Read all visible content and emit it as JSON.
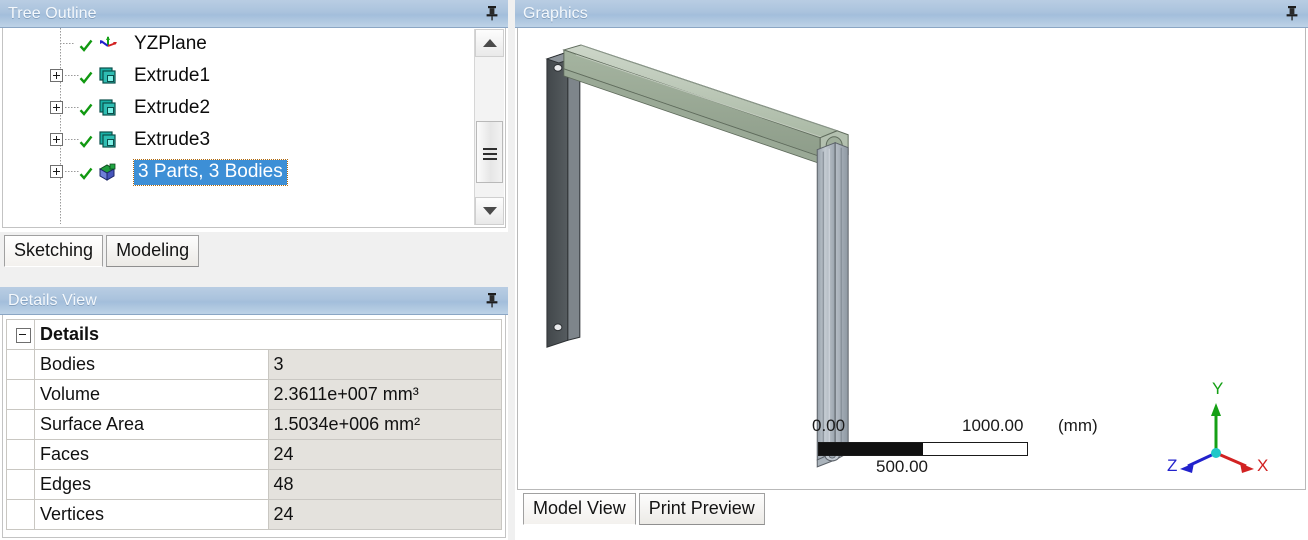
{
  "tree_panel": {
    "title": "Tree Outline",
    "pin_icon": "pushpin-icon",
    "items": [
      {
        "label": "YZPlane",
        "icon": "plane-triad-icon",
        "expandable": false,
        "suppressed": false,
        "selected": false,
        "check": "green-check-icon"
      },
      {
        "label": "Extrude1",
        "icon": "extrude-body-icon",
        "expandable": true,
        "suppressed": false,
        "selected": false,
        "check": "green-check-icon"
      },
      {
        "label": "Extrude2",
        "icon": "extrude-body-icon",
        "expandable": true,
        "suppressed": false,
        "selected": false,
        "check": "green-check-icon"
      },
      {
        "label": "Extrude3",
        "icon": "extrude-body-icon",
        "expandable": true,
        "suppressed": false,
        "selected": false,
        "check": "green-check-icon"
      },
      {
        "label": "3 Parts, 3 Bodies",
        "icon": "parts-bodies-icon",
        "expandable": true,
        "suppressed": false,
        "selected": true,
        "check": "green-check-icon"
      }
    ],
    "scrollbar": {
      "up_icon": "scroll-up-arrow-icon",
      "down_icon": "scroll-down-arrow-icon",
      "thumb_icon": "scroll-thumb-grip-icon"
    },
    "tabs": [
      {
        "label": "Sketching",
        "active": true
      },
      {
        "label": "Modeling",
        "active": false
      }
    ]
  },
  "details_panel": {
    "title": "Details View",
    "pin_icon": "pushpin-icon",
    "group_label": "Details",
    "group_toggle_icon": "collapse-minus-icon",
    "rows": [
      {
        "key": "Bodies",
        "value": "3"
      },
      {
        "key": "Volume",
        "value": "2.3611e+007 mm³"
      },
      {
        "key": "Surface Area",
        "value": "1.5034e+006 mm²"
      },
      {
        "key": "Faces",
        "value": "24"
      },
      {
        "key": "Edges",
        "value": "48"
      },
      {
        "key": "Vertices",
        "value": "24"
      }
    ]
  },
  "graphics_panel": {
    "title": "Graphics",
    "pin_icon": "pushpin-icon",
    "scale_bar": {
      "min_label": "0.00",
      "mid_label": "500.00",
      "max_label": "1000.00",
      "unit_label": "(mm)"
    },
    "triad": {
      "x_label": "X",
      "y_label": "Y",
      "z_label": "Z",
      "x_color": "#d22222",
      "y_color": "#15a015",
      "z_color": "#2222cc",
      "origin_color": "#20c8c8"
    },
    "model": {
      "description": "portal frame assembly of three extruded bodies",
      "bodies": [
        {
          "name": "left-column",
          "color": "#4b5053"
        },
        {
          "name": "top-beam",
          "color": "#a9b7a4"
        },
        {
          "name": "right-column",
          "color": "#a9b2ba"
        }
      ]
    },
    "tabs": [
      {
        "label": "Model View",
        "active": true
      },
      {
        "label": "Print Preview",
        "active": false
      }
    ]
  },
  "colors": {
    "title_bar": "#aac3dd",
    "selection_blue": "#3d8fd6",
    "value_cell": "#e4e2dd",
    "app_background": "#f0f0f0"
  }
}
